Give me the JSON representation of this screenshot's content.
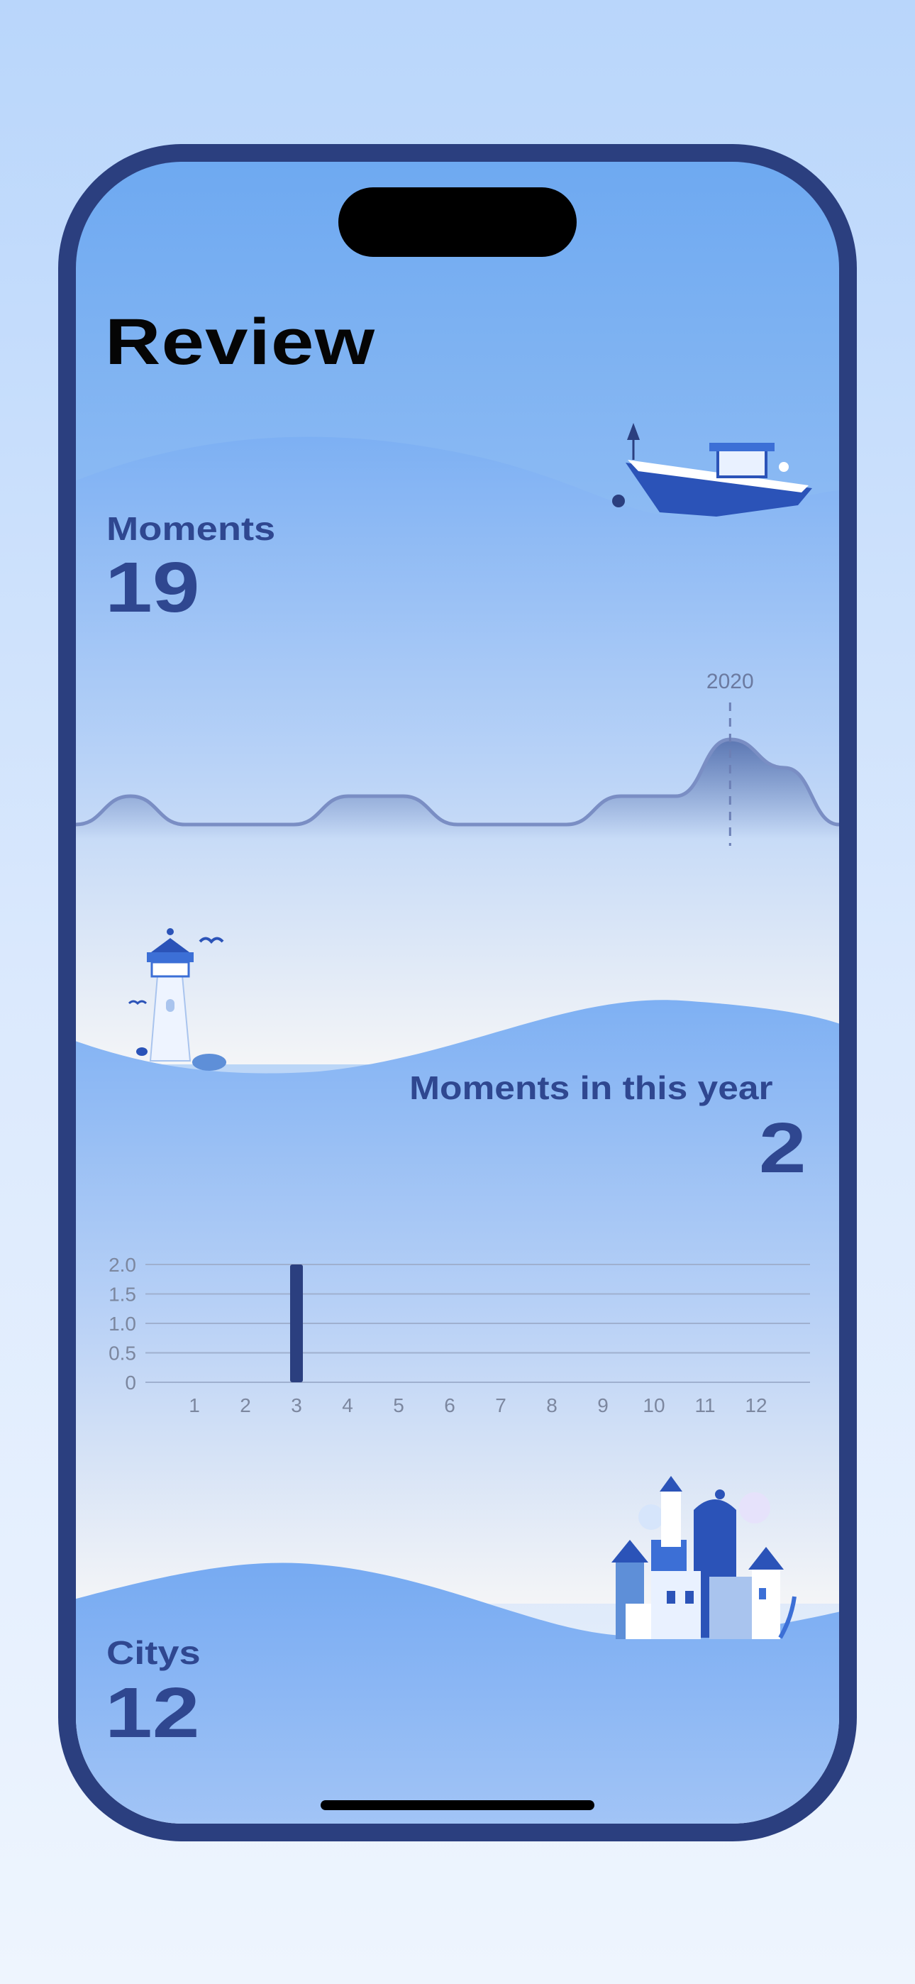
{
  "page": {
    "title": "Review"
  },
  "moments": {
    "label": "Moments",
    "count": "19",
    "marker_label": "2020"
  },
  "moments_year": {
    "label": "Moments in this year",
    "count": "2"
  },
  "citys": {
    "label": "Citys",
    "count": "12"
  },
  "colors": {
    "frame": "#2b3f7f",
    "accent_text": "#2f4790",
    "wave_blue": "#7fb0f3",
    "bar": "#2b3f7f"
  },
  "chart_data": [
    {
      "type": "area",
      "x": [
        "",
        "",
        "",
        "",
        "",
        "",
        "",
        "",
        "",
        "",
        "",
        "",
        "2020",
        "",
        ""
      ],
      "values": [
        0,
        1,
        0,
        0,
        0,
        1,
        1,
        0,
        0,
        0,
        1,
        1,
        3,
        2,
        0
      ],
      "annotations": [
        "2020"
      ]
    },
    {
      "type": "bar",
      "categories": [
        "1",
        "2",
        "3",
        "4",
        "5",
        "6",
        "7",
        "8",
        "9",
        "10",
        "11",
        "12"
      ],
      "values": [
        0,
        0,
        2,
        0,
        0,
        0,
        0,
        0,
        0,
        0,
        0,
        0
      ],
      "yticks": [
        "0",
        "0.5",
        "1.0",
        "1.5",
        "2.0"
      ],
      "ylim": [
        0,
        2
      ],
      "grid": true
    }
  ]
}
